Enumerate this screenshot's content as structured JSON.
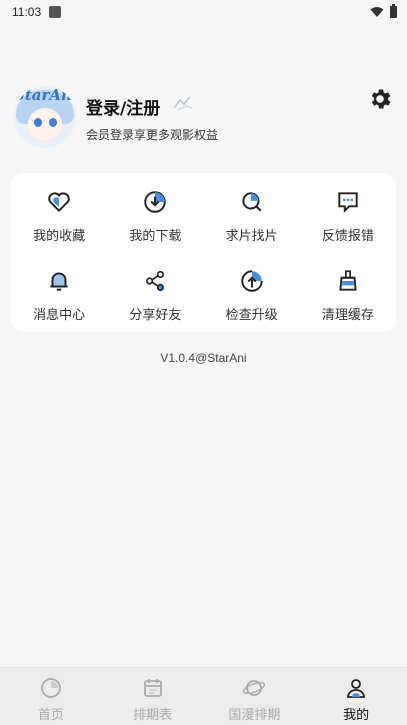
{
  "status_bar": {
    "time": "11:03"
  },
  "profile": {
    "avatar_logo": "StarAni",
    "title": "登录/注册",
    "subtitle": "会员登录享更多观影权益",
    "settings_icon": "gear-icon"
  },
  "menu": {
    "items": [
      {
        "label": "我的收藏",
        "icon": "heart-icon"
      },
      {
        "label": "我的下载",
        "icon": "download-icon"
      },
      {
        "label": "求片找片",
        "icon": "search-film-icon"
      },
      {
        "label": "反馈报错",
        "icon": "feedback-icon"
      },
      {
        "label": "消息中心",
        "icon": "bell-icon"
      },
      {
        "label": "分享好友",
        "icon": "share-icon"
      },
      {
        "label": "检查升级",
        "icon": "upgrade-icon"
      },
      {
        "label": "清理缓存",
        "icon": "broom-icon"
      }
    ]
  },
  "version": "V1.0.4@StarAni",
  "bottom_nav": {
    "items": [
      {
        "label": "首页",
        "icon": "home-icon"
      },
      {
        "label": "排期表",
        "icon": "calendar-icon"
      },
      {
        "label": "国漫排期",
        "icon": "planet-icon"
      },
      {
        "label": "我的",
        "icon": "user-icon"
      }
    ],
    "active_index": 3
  },
  "colors": {
    "accent": "#4a90e2",
    "background": "#f6f6f6",
    "card": "#ffffff",
    "nav_bg": "#ececec"
  }
}
